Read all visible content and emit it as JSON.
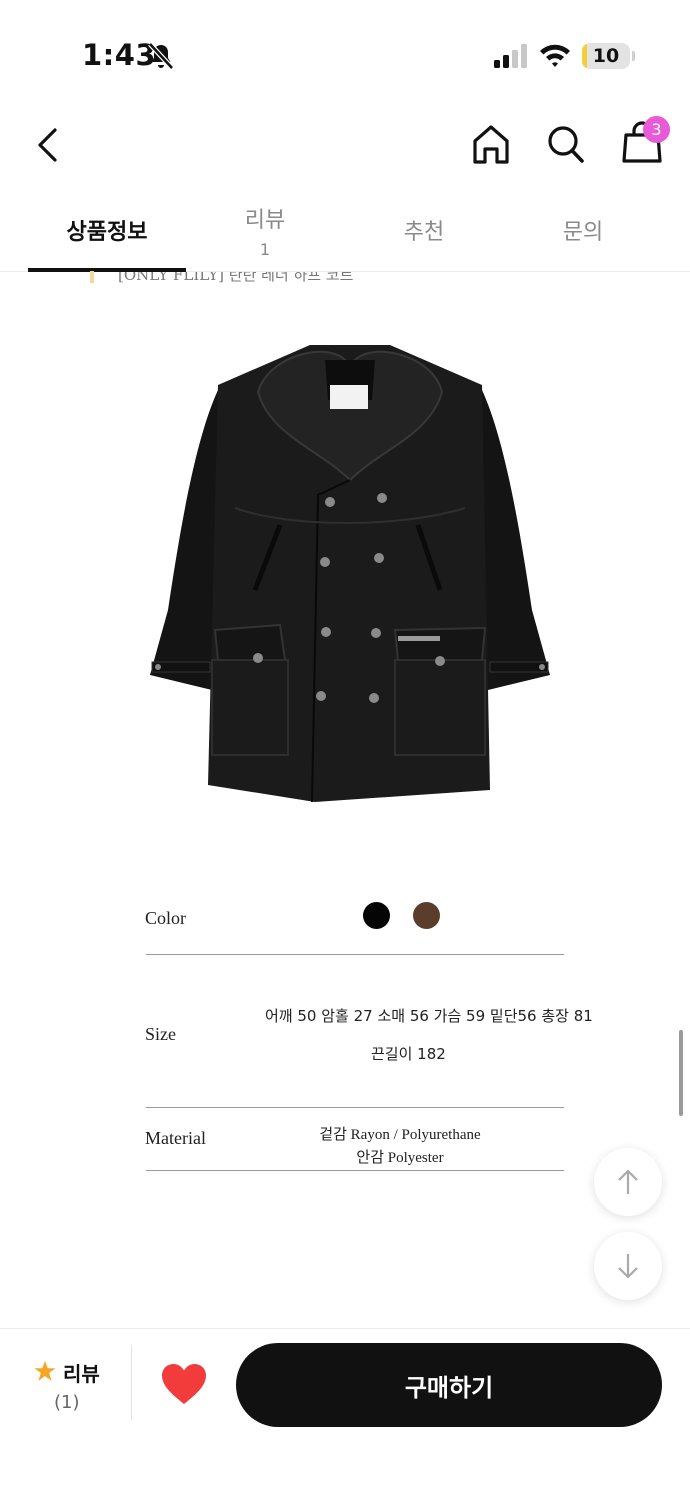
{
  "status_bar": {
    "time": "1:43",
    "battery_percent": "10",
    "battery_level": 0.1
  },
  "header": {
    "cart_badge": "3",
    "icons": [
      "chevron-left-icon",
      "home-icon",
      "search-icon",
      "shopping-bag-icon"
    ]
  },
  "tabs": [
    {
      "label": "상품정보",
      "active": true
    },
    {
      "label": "리뷰",
      "count": "1"
    },
    {
      "label": "추천"
    },
    {
      "label": "문의"
    }
  ],
  "caption_cut": "[ONLY FLILY] 탄탄 레더 하프 코트",
  "product": {
    "color_label": "Color",
    "colors": [
      "#050505",
      "#5a3d2b"
    ],
    "size_label": "Size",
    "size_line1": "어깨 50 암홀 27 소매 56 가슴 59 밑단56 총장 81",
    "size_line2": "끈길이 182",
    "material_label": "Material",
    "material_line1": "겉감 Rayon / Polyurethane",
    "material_line2": "안감 Polyester"
  },
  "bottom_bar": {
    "review_label": "리뷰",
    "review_count": "(1)",
    "buy_label": "구매하기",
    "accent_colors": {
      "star": "#f5a623",
      "heart": "#f23b3b"
    }
  }
}
